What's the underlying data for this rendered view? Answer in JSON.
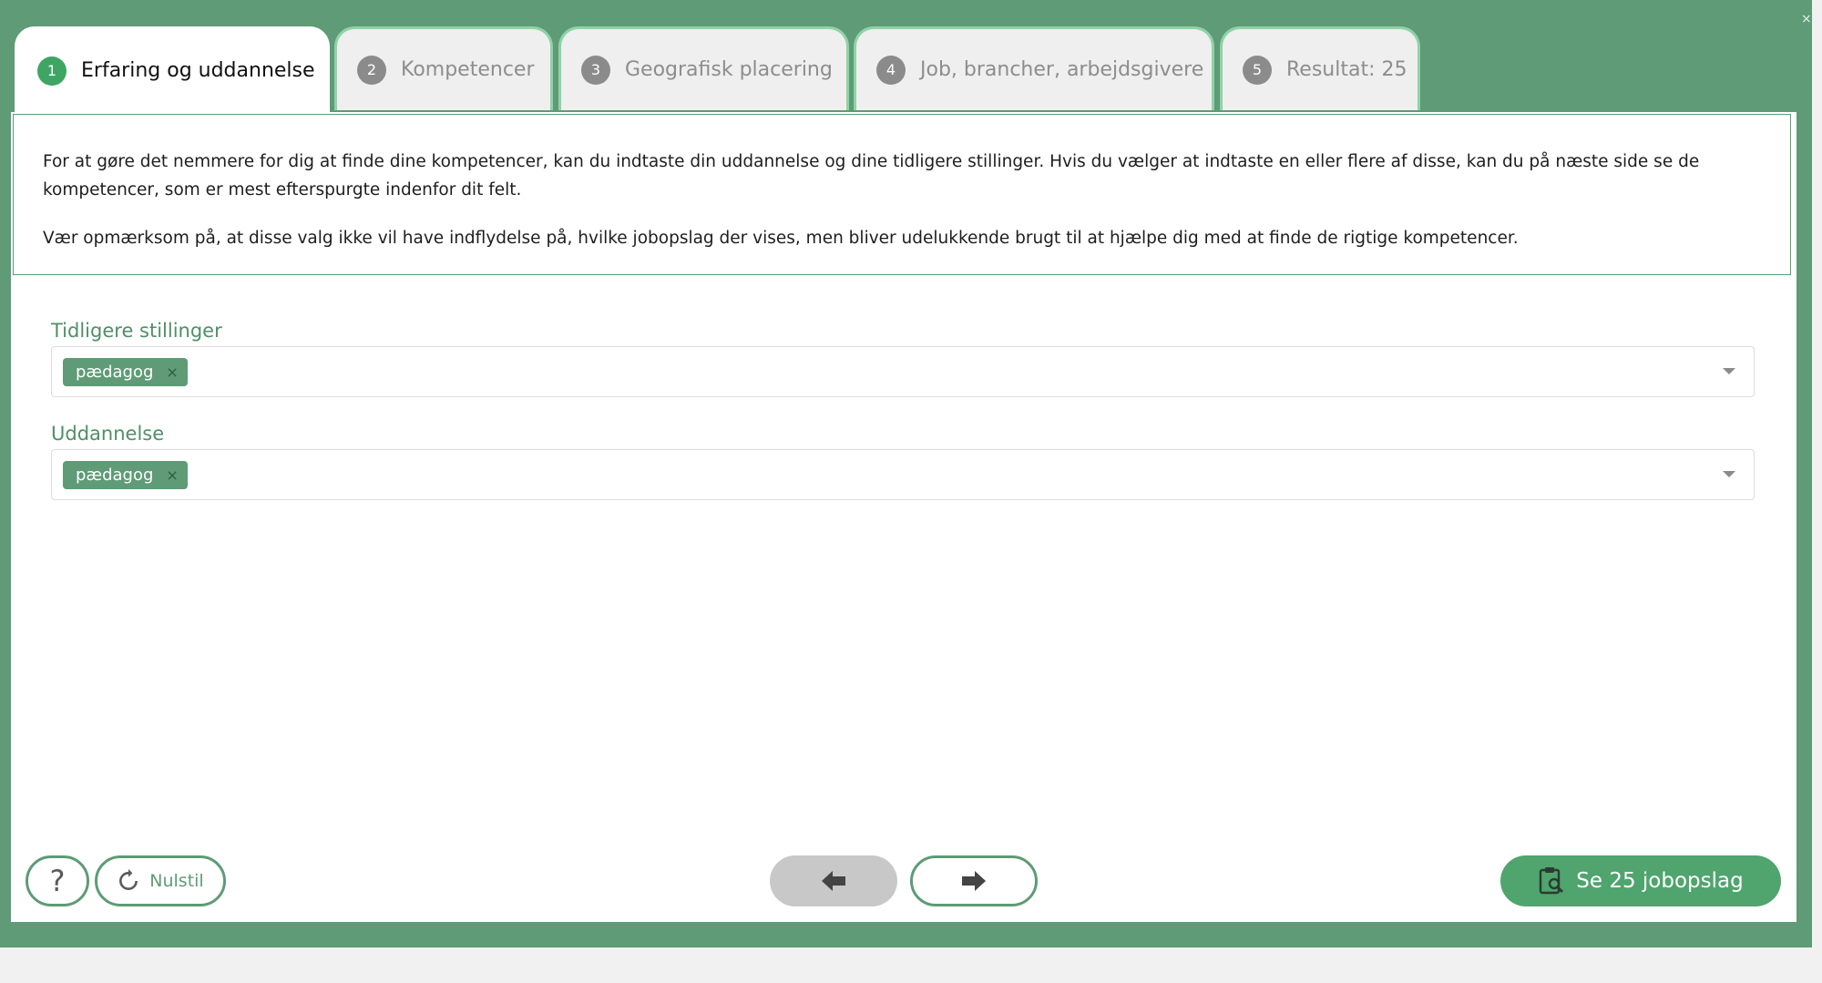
{
  "window": {
    "close_glyph": "×"
  },
  "tabs": [
    {
      "number": "1",
      "label": "Erfaring og uddannelse",
      "active": true
    },
    {
      "number": "2",
      "label": "Kompetencer",
      "active": false
    },
    {
      "number": "3",
      "label": "Geografisk placering",
      "active": false
    },
    {
      "number": "4",
      "label": "Job, brancher, arbejdsgivere",
      "active": false
    },
    {
      "number": "5",
      "label": "Resultat: 25",
      "active": false
    }
  ],
  "info": {
    "paragraph_1": "For at gøre det nemmere for dig at finde dine kompetencer, kan du indtaste din uddannelse og dine tidligere stillinger. Hvis du vælger at indtaste en eller flere af disse, kan du på næste side se de kompetencer, som er mest efterspurgte indenfor dit felt.",
    "paragraph_2": "Vær opmærksom på, at disse valg ikke vil have indflydelse på, hvilke jobopslag der vises, men bliver udelukkende brugt til at hjælpe dig med at finde de rigtige kompetencer."
  },
  "fields": {
    "previous_positions": {
      "label": "Tidligere stillinger",
      "chips": [
        "pædagog"
      ]
    },
    "education": {
      "label": "Uddannelse",
      "chips": [
        "pædagog"
      ]
    }
  },
  "chip_remove_glyph": "×",
  "footer": {
    "help_label": "?",
    "reset_label": "Nulstil",
    "jobs_button_label": "Se 25 jobopslag"
  },
  "colors": {
    "frame": "#5e9b76",
    "accent": "#3fa565",
    "tab_border": "#8fd3a6",
    "chip": "#5e9b76",
    "primary_button": "#4fa56d"
  },
  "icons": {
    "reset": "refresh-icon",
    "prev": "arrow-left-icon",
    "next": "arrow-right-icon",
    "jobs": "clipboard-search-icon",
    "dropdown": "caret-down-icon"
  }
}
